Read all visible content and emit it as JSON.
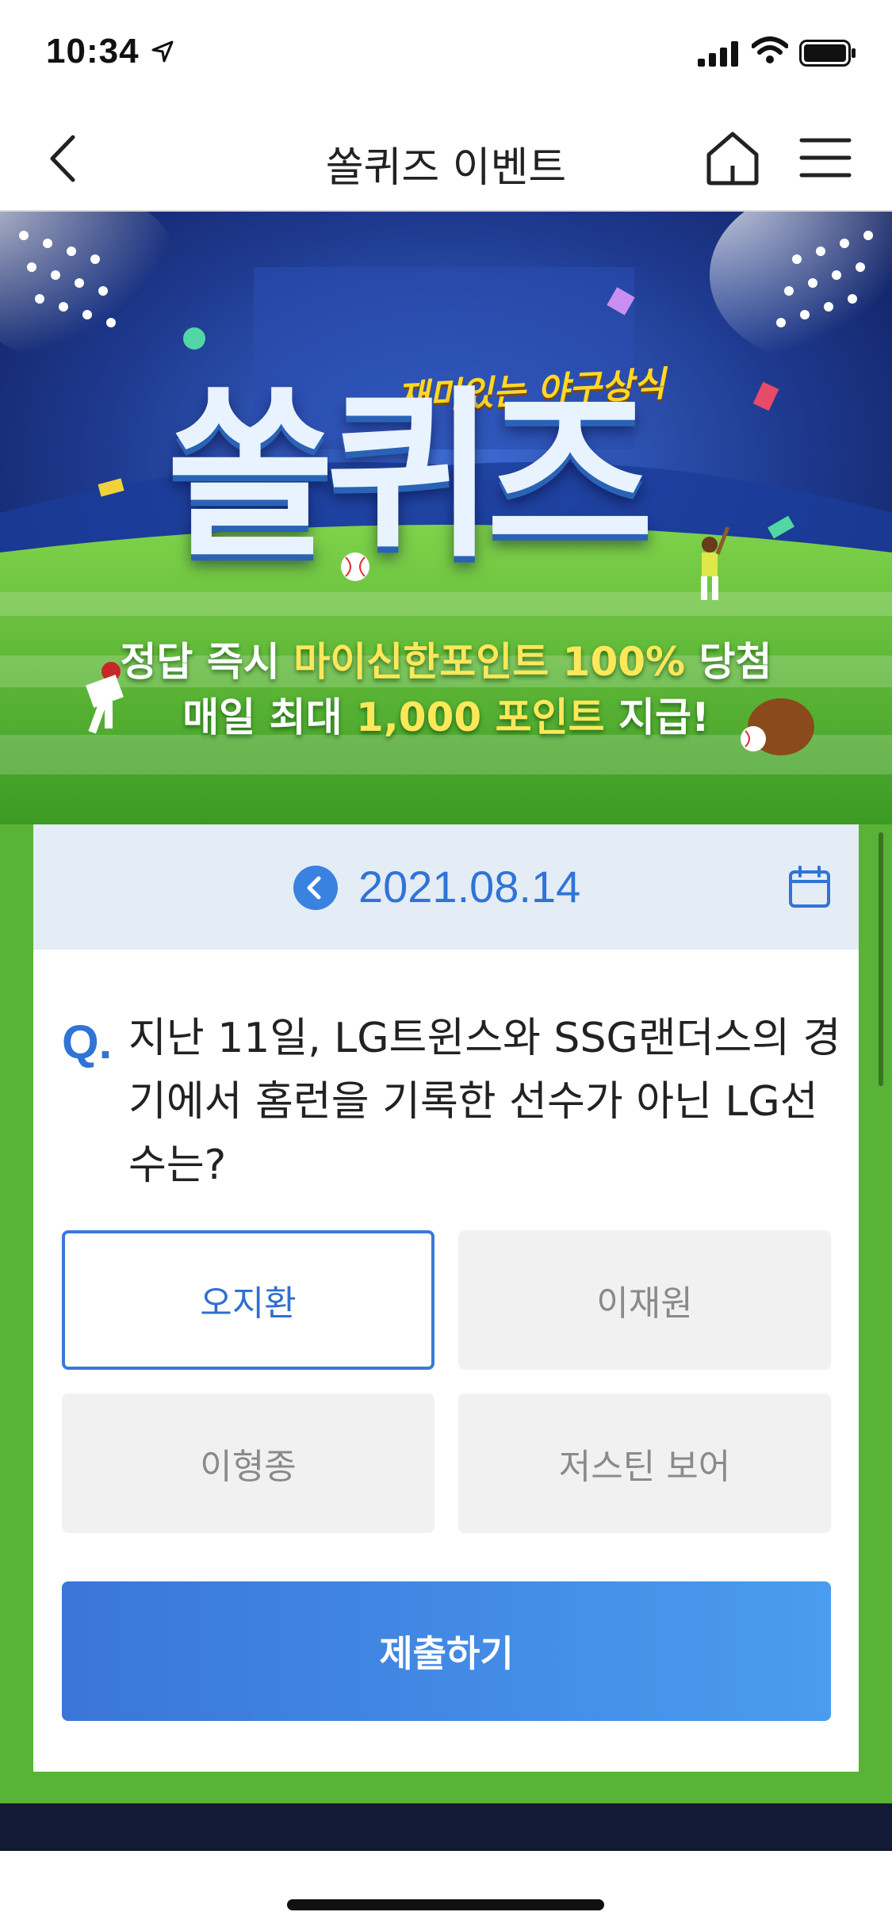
{
  "status_bar": {
    "time": "10:34",
    "icons": [
      "location-arrow-icon",
      "cellular-signal-icon",
      "wifi-icon",
      "battery-icon"
    ]
  },
  "nav": {
    "title": "쏠퀴즈 이벤트",
    "back_icon": "chevron-left-icon",
    "home_icon": "home-icon",
    "menu_icon": "hamburger-menu-icon"
  },
  "banner": {
    "tagline": "재미있는 야구상식",
    "logo_text": "쏠퀴즈",
    "line1_prefix": "정답 즉시 ",
    "line1_highlight": "마이신한포인트 100%",
    "line1_suffix": " 당첨",
    "line2_prefix": "매일 최대 ",
    "line2_highlight": "1,000 포인트",
    "line2_suffix": " 지급!"
  },
  "quiz": {
    "date": "2021.08.14",
    "prev_icon": "chevron-left-circle-icon",
    "calendar_icon": "calendar-icon",
    "q_label": "Q.",
    "question": "지난 11일, LG트윈스와 SSG랜더스의 경기에서 홈런을 기록한 선수가 아닌 LG선수는?",
    "options": [
      "오지환",
      "이재원",
      "이형종",
      "저스틴 보어"
    ],
    "selected_index": 0,
    "submit_label": "제출하기"
  },
  "colors": {
    "accent": "#2f74d6",
    "field_green": "#58b336",
    "date_bar": "#e4ecf6",
    "option_bg": "#f1f1f1",
    "highlight_yellow": "#ffe75a"
  }
}
